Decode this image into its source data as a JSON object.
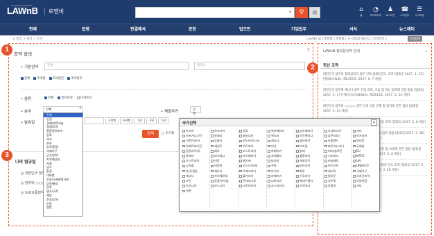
{
  "header": {
    "logo": "LAWnB",
    "logo_sub": "THOMSON REUTERS",
    "logo_kr": "로앤비",
    "search_select": "",
    "icons": [
      {
        "name": "home-icon",
        "glyph": "⌂",
        "label": "홈"
      },
      {
        "name": "mypage-icon",
        "glyph": "◔",
        "label": "마이페이지"
      },
      {
        "name": "notice-icon",
        "glyph": "♟",
        "label": "로그아웃"
      },
      {
        "name": "help-icon",
        "glyph": "☎",
        "label": "고객센터"
      },
      {
        "name": "sitemap-icon",
        "glyph": "☰",
        "label": "사이트맵"
      }
    ]
  },
  "nav": [
    "판례",
    "법령",
    "판결해석",
    "문헌",
    "법조인",
    "기업법무",
    "서식",
    "뉴스레터"
  ],
  "breadcrumb": "◎ 법령 > 법령 > 조약",
  "subnav": "LawNb 法 | 법령통 | 개정통 | 1~2018-08-22 | 조약번호 |",
  "subnav_tag": "조약검색",
  "panel": {
    "title": "조약 검색",
    "close": "×",
    "basic_label": "기본검색",
    "basic_ph": "전체",
    "basic_ph2": "제외어",
    "scope": [
      {
        "label": "전체",
        "on": true
      },
      {
        "label": "조약명",
        "on": true
      },
      {
        "label": "조약본문",
        "on": true
      },
      {
        "label": "조약번호",
        "on": true
      }
    ],
    "kind_label": "종류",
    "kinds": [
      {
        "label": "전체",
        "on": true
      },
      {
        "label": "양자조약",
        "on": true
      },
      {
        "label": "다자조약",
        "on": false
      }
    ],
    "field_label": "분야",
    "field_value": "전체",
    "country_label": "체결국가",
    "country_btn": "선택",
    "date_label": "발효일",
    "date_btns": [
      "3개월",
      "6개월",
      "1년",
      "3년",
      "5년"
    ],
    "search_btn": "검색",
    "reset": "□ 초기화"
  },
  "field_options": [
    "전체",
    "인권",
    "경제/과학기술",
    "경제/무역",
    "통합일반조약",
    "강화",
    "외교",
    "조약",
    "도로/환경",
    "국제기구",
    "군사/안보",
    "지적재산권",
    "사회",
    "남극",
    "환경",
    "대륙붕",
    "운송/국제협력사항",
    "무역/통상",
    "문화",
    "영사/국적",
    "해양",
    "운송/무역",
    "인원",
    "일반"
  ],
  "popup": {
    "title": "국가선택",
    "close": "×",
    "cols": [
      [
        "아시아",
        "아프가니스탄",
        "이란/이라크",
        "아제르바이잔",
        "앙골라/미국",
        "알제리",
        "오스트리아",
        "싱가폴",
        "한국/일본",
        "캐나다",
        "오만",
        "도미니카",
        "일본"
      ],
      [
        "아프리카",
        "알제리",
        "앙골라",
        "세인트",
        "베르",
        "보츠와나",
        "이란",
        "미얀마",
        "캐나다",
        "카보베르데",
        "몽골/아이슬",
        "보스니아"
      ],
      [
        "유럽",
        "알바니아",
        "안도라/모나코",
        "라트비아",
        "오스트리아",
        "라이베리아",
        "벨기에",
        "보스니아/헤",
        "르체고비나",
        "불가리아",
        "몬테네그로",
        "크로아티아"
      ],
      [
        "북아메리카",
        "멕시코",
        "캐나다",
        "미국",
        "자메이카",
        "과테말라",
        "파나마",
        "쿠바",
        "아이티",
        "자메이카",
        "니카라과",
        "코스타리카"
      ],
      [
        "남아메리카",
        "아르헨티나",
        "볼리비아",
        "브라질",
        "칠레",
        "콜롬비아",
        "에콰도르",
        "파라과이",
        "페루",
        "우루과이",
        "베네수엘라",
        "가이아나"
      ],
      [
        "오세아니아",
        "호주/피지",
        "뉴질랜드",
        "파푸아뉴기니",
        "피지/솔로몬",
        "키리바시",
        "마셜제도",
        "마이크로",
        "네시아",
        "팔라우",
        "나우루",
        "투발루"
      ],
      [
        "기타",
        "아프리카",
        "바티칸",
        "공해상",
        "EU",
        "NATO",
        "UN",
        "UNESCO",
        "국제기구",
        "다자간조약",
        "유럽연합",
        "기타"
      ]
    ]
  },
  "recent": {
    "title": "나의 법규일",
    "items": [
      "대한민국 정부와 ○○○○ 정부간 소득에 대한 조세의 이중과세 회피와 탈세 방지를 위한 협약",
      "정부와 ○○○ 공화국 정부간의 투자증진 및 상호보호에 관한 협정",
      "도로교통협약"
    ]
  },
  "right": {
    "title": "LAWnB 정보문의처 안내",
    "section": "최신 조약",
    "items": [
      "대한민국 정부와 칠레공화국 정부 간의 범죄인인도 조약 [발효일 2017. 4. 22] [칠레(CHILE), 제2355호, 2017. 6. 7 개정]",
      "대한민국 정부와 캐나다 정부 간의 과학, 기술 및 혁신 협력에 관한 협정 [발효일 2017. 5. 17] [캐나다(CANADA), 제2353호, 2017. 5. 24 개정]",
      "대한민국 정부와 ○○○○ 정부 간의 사증 면제 및 입국에 관한 협정 [발효일 2017. 5. 24 개정]",
      "대한민국 정부와 ○○○○ 정부 간의 범죄인 인도 조약 [발효일 2017. 5. 8 개정]",
      "대한민국 정부와 슬로바키아 공화국 정부 간의 협력 협정 [발효일 2017. 5. 10] [슬로바키아(SLOVAKIA), 2017. 5. 8 개정]",
      "대한민국 정부와 ○○○○ 정부 간의 투자의 증진 및 보호에 관한 협정 [발효일 2017. 5. 12] [인도(INDIA), 제2349호, 2017. 5. 8 개정]",
      "대한민국 정부와 마셜제도공화국 정부 간의 범죄인 인도 조약 [발효일 2017. 5. 17] [마셜제도(마셜 제도), 제2350호, 2017. 4. 26 개정]"
    ]
  },
  "markers": [
    "1",
    "2",
    "3"
  ]
}
